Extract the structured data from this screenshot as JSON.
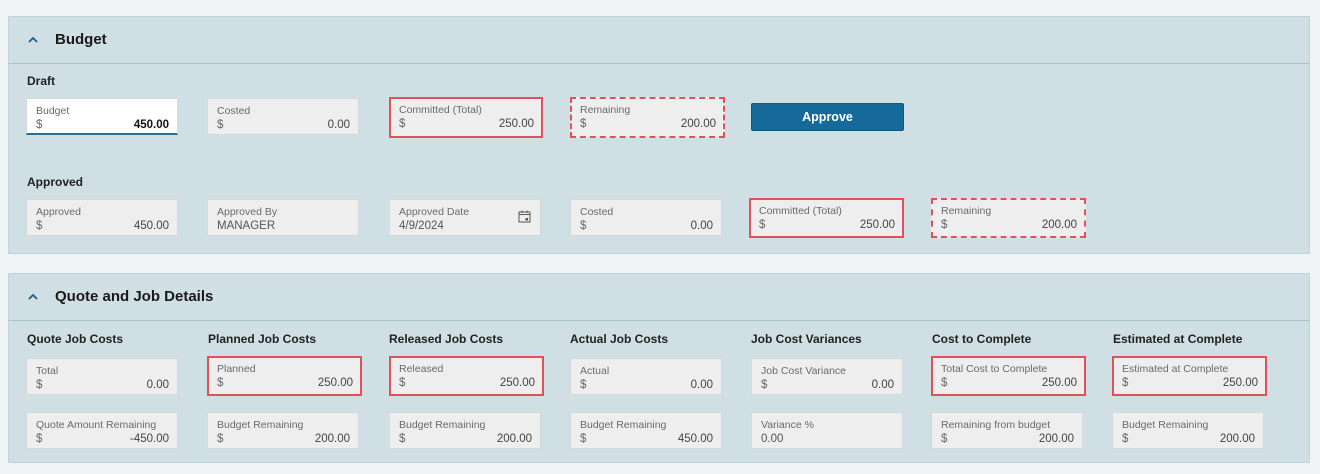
{
  "budget": {
    "title": "Budget",
    "draft": {
      "label": "Draft",
      "fields": [
        {
          "label": "Budget",
          "currency": "$",
          "value": "450.00"
        },
        {
          "label": "Costed",
          "currency": "$",
          "value": "0.00"
        },
        {
          "label": "Committed (Total)",
          "currency": "$",
          "value": "250.00"
        },
        {
          "label": "Remaining",
          "currency": "$",
          "value": "200.00"
        }
      ],
      "approve_label": "Approve"
    },
    "approved": {
      "label": "Approved",
      "fields": [
        {
          "label": "Approved",
          "currency": "$",
          "value": "450.00"
        },
        {
          "label": "Approved By",
          "value": "MANAGER"
        },
        {
          "label": "Approved Date",
          "value": "4/9/2024",
          "icon": "calendar-icon"
        },
        {
          "label": "Costed",
          "currency": "$",
          "value": "0.00"
        },
        {
          "label": "Committed (Total)",
          "currency": "$",
          "value": "250.00"
        },
        {
          "label": "Remaining",
          "currency": "$",
          "value": "200.00"
        }
      ]
    }
  },
  "quote": {
    "title": "Quote and Job Details",
    "columns": [
      {
        "title": "Quote Job Costs",
        "fields": [
          {
            "label": "Total",
            "currency": "$",
            "value": "0.00"
          },
          {
            "label": "Quote Amount Remaining",
            "currency": "$",
            "value": "-450.00"
          }
        ]
      },
      {
        "title": "Planned Job Costs",
        "fields": [
          {
            "label": "Planned",
            "currency": "$",
            "value": "250.00"
          },
          {
            "label": "Budget Remaining",
            "currency": "$",
            "value": "200.00"
          }
        ]
      },
      {
        "title": "Released Job Costs",
        "fields": [
          {
            "label": "Released",
            "currency": "$",
            "value": "250.00"
          },
          {
            "label": "Budget Remaining",
            "currency": "$",
            "value": "200.00"
          }
        ]
      },
      {
        "title": "Actual Job Costs",
        "fields": [
          {
            "label": "Actual",
            "currency": "$",
            "value": "0.00"
          },
          {
            "label": "Budget Remaining",
            "currency": "$",
            "value": "450.00"
          }
        ]
      },
      {
        "title": "Job Cost Variances",
        "fields": [
          {
            "label": "Job Cost Variance",
            "currency": "$",
            "value": "0.00"
          },
          {
            "label": "Variance %",
            "value": "0.00"
          }
        ]
      },
      {
        "title": "Cost to Complete",
        "fields": [
          {
            "label": "Total Cost to Complete",
            "currency": "$",
            "value": "250.00"
          },
          {
            "label": "Remaining from budget",
            "currency": "$",
            "value": "200.00"
          }
        ]
      },
      {
        "title": "Estimated at Complete",
        "fields": [
          {
            "label": "Estimated at Complete",
            "currency": "$",
            "value": "250.00"
          },
          {
            "label": "Budget Remaining",
            "currency": "$",
            "value": "200.00"
          }
        ]
      }
    ]
  },
  "colors": {
    "panel_bg": "#cfdfe4",
    "field_bg": "#eeeeee",
    "highlight_red": "#e0525a",
    "primary_button": "#166a9a",
    "chevron": "#1f5f8b"
  }
}
